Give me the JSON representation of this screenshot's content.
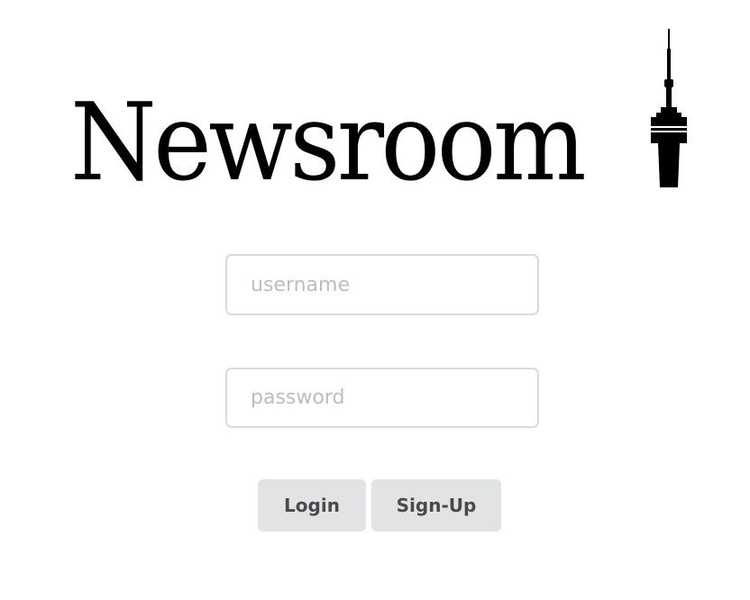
{
  "logo": {
    "wordmark": "Newsroom",
    "emblem_icon": "cn-tower-icon"
  },
  "login_form": {
    "username_placeholder": "username",
    "username_value": "",
    "password_placeholder": "password",
    "password_value": "",
    "login_label": "Login",
    "signup_label": "Sign-Up"
  },
  "colors": {
    "background": "#ffffff",
    "text": "#000000",
    "input_border": "#dadada",
    "placeholder": "#bdbdbd",
    "button_bg": "#e2e3e5",
    "button_text": "#4a4a4a"
  }
}
